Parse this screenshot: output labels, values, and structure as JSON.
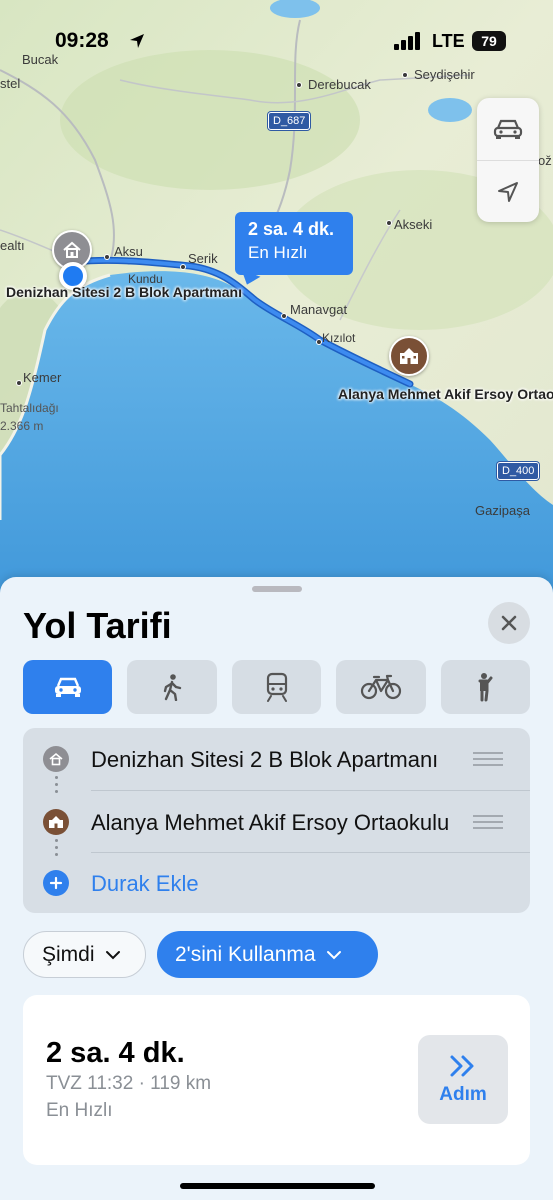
{
  "status_bar": {
    "time": "09:28",
    "carrier": "LTE",
    "battery": "79"
  },
  "map": {
    "labels": {
      "bucak": "Bucak",
      "stel": "stel",
      "derebucak": "Derebucak",
      "seydisehir": "Seydişehir",
      "aksu": "Aksu",
      "serik": "Serik",
      "kundu": "Kundu",
      "akseki": "Akseki",
      "manavgat": "Manavgat",
      "kizilot": "Kızılot",
      "kemer": "Kemer",
      "tahtalidagi": "Tahtalıdağı",
      "elevation": "2.366 m",
      "gazipasa": "Gazipaşa",
      "ealti": "ealtı",
      "oz": "ož"
    },
    "road_badges": {
      "d687": "D_687",
      "d400": "D_400"
    },
    "origin_label": "Denizhan Sitesi 2 B Blok Apartmanı",
    "destination_label": "Alanya Mehmet Akif Ersoy Ortaokulu",
    "route_callout": {
      "time": "2 sa. 4 dk.",
      "type": "En Hızlı"
    },
    "controls": [
      "car-icon",
      "location-arrow-icon"
    ]
  },
  "sheet": {
    "title": "Yol Tarifi",
    "transport_modes": [
      {
        "icon": "car-icon",
        "active": true
      },
      {
        "icon": "walk-icon",
        "active": false
      },
      {
        "icon": "transit-icon",
        "active": false
      },
      {
        "icon": "bicycle-icon",
        "active": false
      },
      {
        "icon": "rideshare-icon",
        "active": false
      }
    ],
    "stops": {
      "origin": "Denizhan Sitesi 2 B Blok Apartmanı",
      "destination": "Alanya Mehmet Akif Ersoy Ortaokulu",
      "add_stop": "Durak Ekle"
    },
    "chips": {
      "time": "Şimdi",
      "options": "2'sini Kullanma"
    },
    "route": {
      "duration": "2 sa. 4 dk.",
      "details": "TVZ 11:32 · 119 km",
      "type": "En Hızlı",
      "go_label": "Adım"
    }
  },
  "colors": {
    "accent": "#2f80ed",
    "sea": "#4ea3e0",
    "land": "#e5ecd0"
  }
}
